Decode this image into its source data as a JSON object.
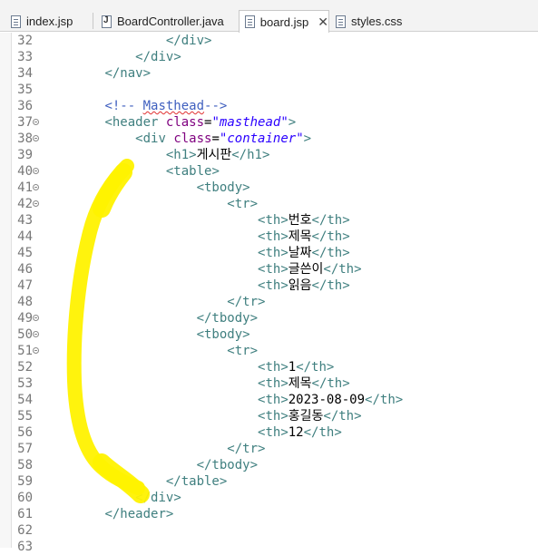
{
  "tabs": [
    {
      "label": "index.jsp",
      "icon": "jsp-file-icon",
      "active": false
    },
    {
      "label": "BoardController.java",
      "icon": "java-file-icon",
      "active": false
    },
    {
      "label": "board.jsp",
      "icon": "jsp-file-icon",
      "active": true,
      "close": "✕"
    },
    {
      "label": "styles.css",
      "icon": "css-file-icon",
      "active": false
    }
  ],
  "lines": [
    {
      "n": "32",
      "code": "                </div>"
    },
    {
      "n": "33",
      "code": "            </div>"
    },
    {
      "n": "34",
      "code": "        </nav>"
    },
    {
      "n": "35",
      "code": ""
    },
    {
      "n": "36",
      "code": "        <!-- Masthead-->"
    },
    {
      "n": "37",
      "code": "        <header class=\"masthead\">"
    },
    {
      "n": "38",
      "code": "            <div class=\"container\">"
    },
    {
      "n": "39",
      "code": "                <h1>게시판</h1>"
    },
    {
      "n": "40",
      "code": "                <table>"
    },
    {
      "n": "41",
      "code": "                    <tbody>"
    },
    {
      "n": "42",
      "code": "                        <tr>"
    },
    {
      "n": "43",
      "code": "                            <th>번호</th>"
    },
    {
      "n": "44",
      "code": "                            <th>제목</th>"
    },
    {
      "n": "45",
      "code": "                            <th>날짜</th>"
    },
    {
      "n": "46",
      "code": "                            <th>글쓴이</th>"
    },
    {
      "n": "47",
      "code": "                            <th>읽음</th>"
    },
    {
      "n": "48",
      "code": "                        </tr>"
    },
    {
      "n": "49",
      "code": "                    </tbody>"
    },
    {
      "n": "50",
      "code": "                    <tbody>"
    },
    {
      "n": "51",
      "code": "                        <tr>"
    },
    {
      "n": "52",
      "code": "                            <th>1</th>"
    },
    {
      "n": "53",
      "code": "                            <th>제목</th>"
    },
    {
      "n": "54",
      "code": "                            <th>2023-08-09</th>"
    },
    {
      "n": "55",
      "code": "                            <th>홍길동</th>"
    },
    {
      "n": "56",
      "code": "                            <th>12</th>"
    },
    {
      "n": "57",
      "code": "                        </tr>"
    },
    {
      "n": "58",
      "code": "                    </tbody>"
    },
    {
      "n": "59",
      "code": "                </table>"
    },
    {
      "n": "60",
      "code": "            </div>"
    },
    {
      "n": "61",
      "code": "        </header>"
    },
    {
      "n": "62",
      "code": ""
    },
    {
      "n": "63",
      "code": ""
    }
  ],
  "colors": {
    "tag": "#3f7f7f",
    "attr": "#7f007f",
    "value": "#2a00ff",
    "comment": "#3f5fbf",
    "highlight": "#fff200"
  }
}
